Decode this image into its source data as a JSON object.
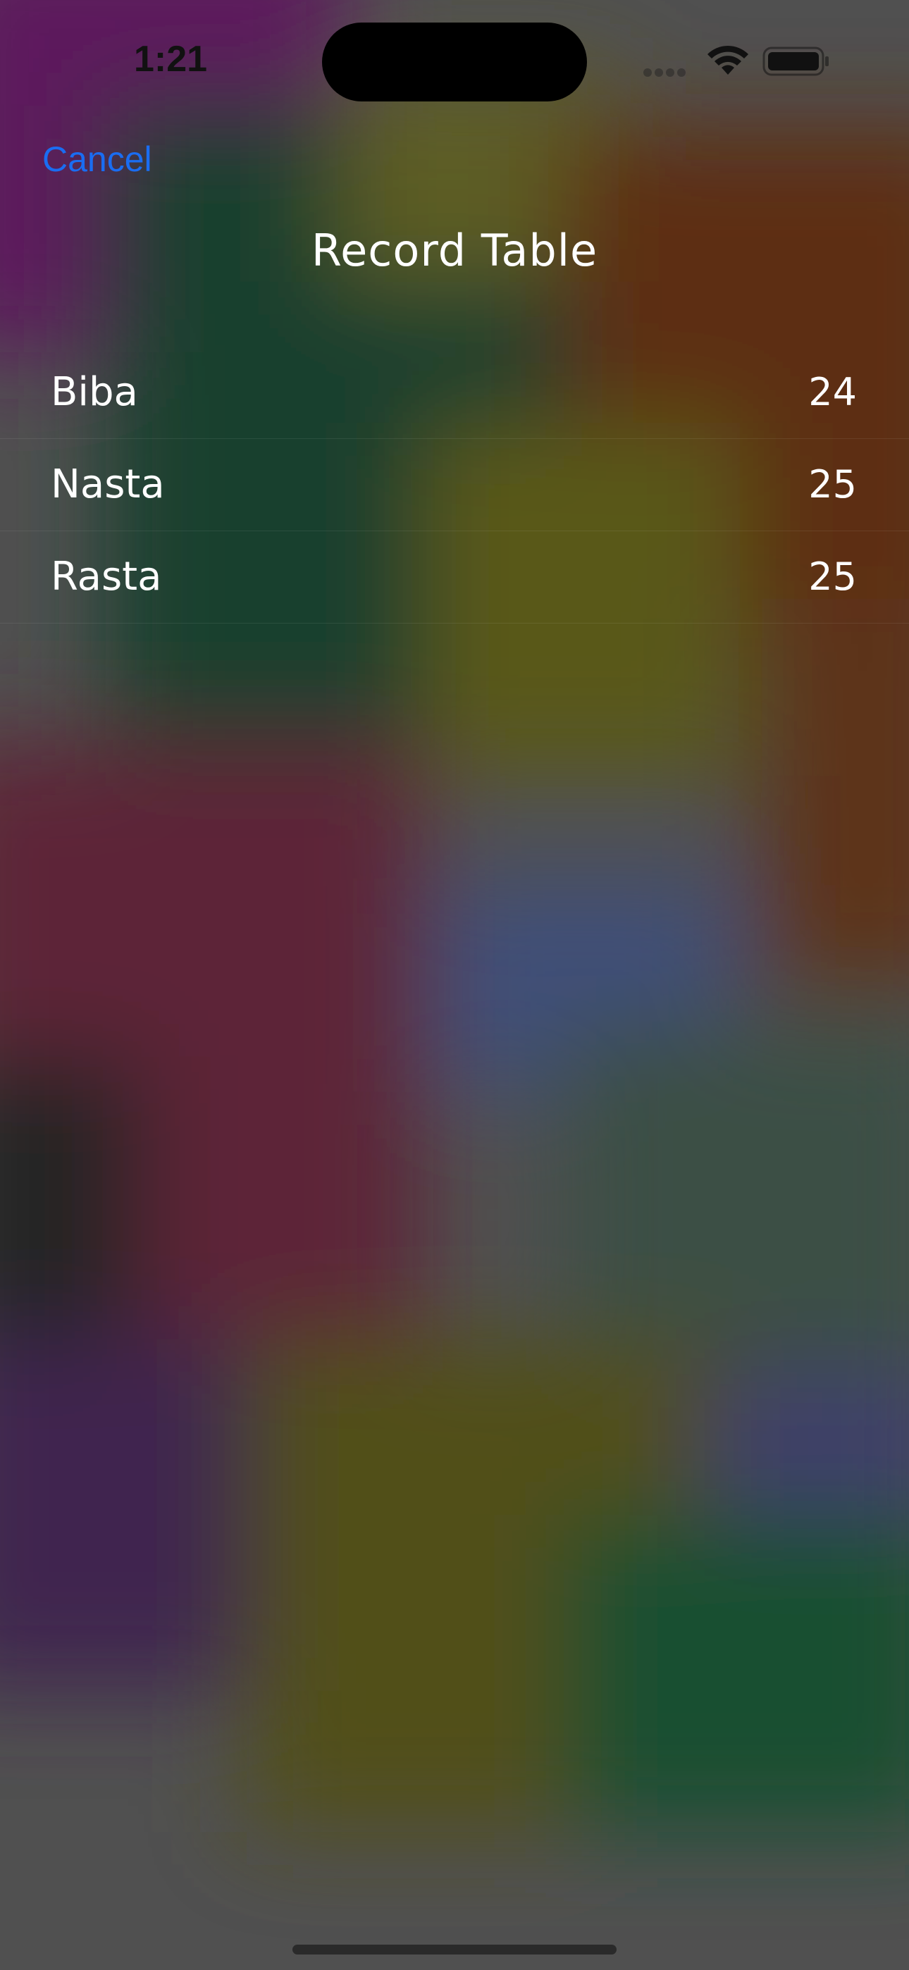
{
  "status_bar": {
    "time": "1:21",
    "wifi_icon": "wifi-icon",
    "battery_icon": "battery-icon",
    "signal_icon": "cellular-signal-icon"
  },
  "nav": {
    "cancel_label": "Cancel",
    "title": "Record Table"
  },
  "records": [
    {
      "name": "Biba",
      "score": "24"
    },
    {
      "name": "Nasta",
      "score": "25"
    },
    {
      "name": "Rasta",
      "score": "25"
    }
  ],
  "colors": {
    "accent": "#1a6df2",
    "text": "#ffffff"
  }
}
